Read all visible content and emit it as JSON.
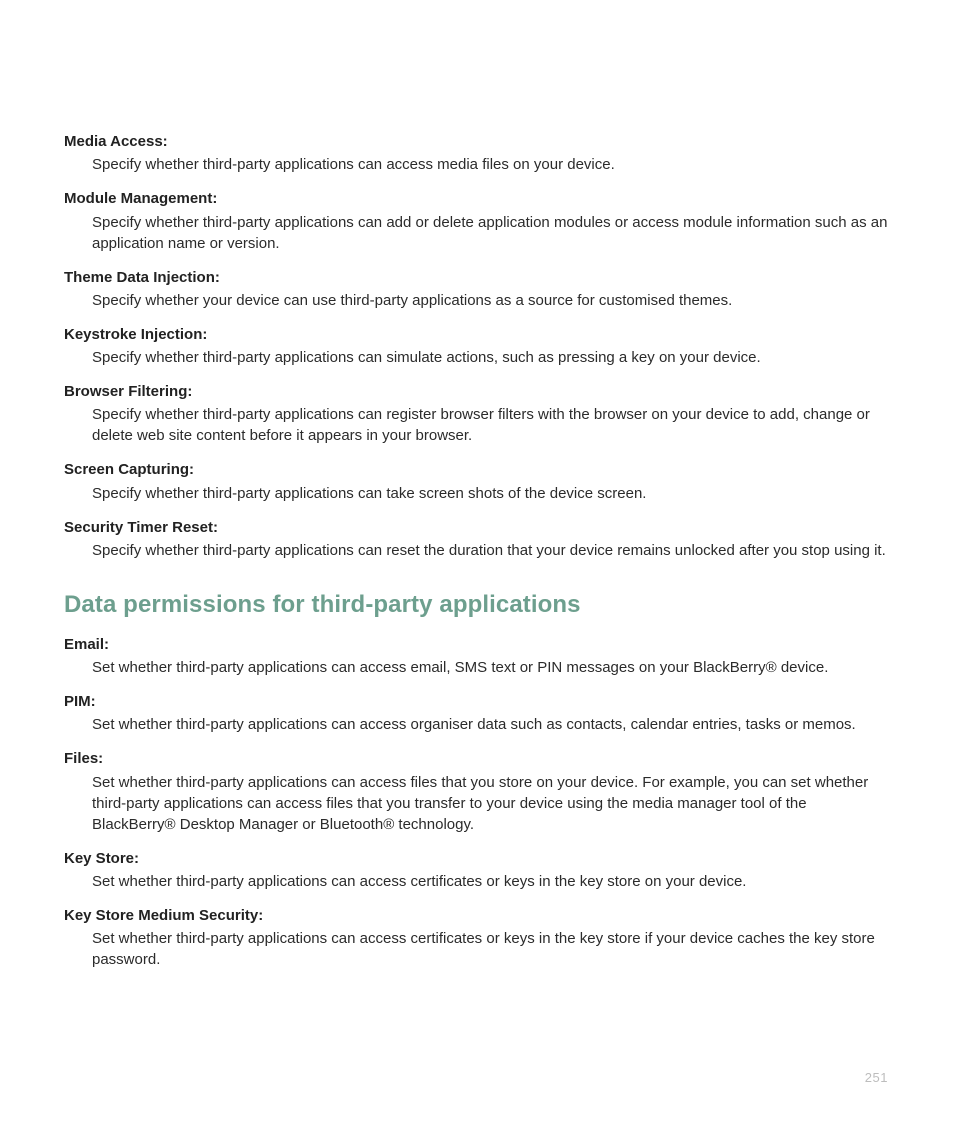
{
  "section1": {
    "items": [
      {
        "term": "Media Access:",
        "desc": "Specify whether third-party applications can access media files on your device."
      },
      {
        "term": "Module Management:",
        "desc": "Specify whether third-party applications can add or delete application modules or access module information such as an application name or version."
      },
      {
        "term": "Theme Data Injection:",
        "desc": "Specify whether your device can use third-party applications as a source for customised themes."
      },
      {
        "term": "Keystroke Injection:",
        "desc": "Specify whether third-party applications can simulate actions, such as pressing a key on your device."
      },
      {
        "term": "Browser Filtering:",
        "desc": "Specify whether third-party applications can register browser filters with the browser on your device to add, change or delete web site content before it appears in your browser."
      },
      {
        "term": "Screen Capturing:",
        "desc": "Specify whether third-party applications can take screen shots of the device screen."
      },
      {
        "term": "Security Timer Reset:",
        "desc": "Specify whether third-party applications can reset the duration that your device remains unlocked after you stop using it."
      }
    ]
  },
  "section2": {
    "heading": "Data permissions for third-party applications",
    "heading_color": "#6d9f8e",
    "items": [
      {
        "term": "Email:",
        "desc": "Set whether third-party applications can access email, SMS text or PIN messages on your BlackBerry® device."
      },
      {
        "term": "PIM:",
        "desc": "Set whether third-party applications can access organiser data such as contacts, calendar entries, tasks or memos."
      },
      {
        "term": "Files:",
        "desc": "Set whether third-party applications can access files that you store on your device. For example, you can set whether third-party applications can access files that you transfer to your device using the media manager tool of the BlackBerry® Desktop Manager or Bluetooth® technology."
      },
      {
        "term": "Key Store:",
        "desc": "Set whether third-party applications can access certificates or keys in the key store on your device."
      },
      {
        "term": "Key Store Medium Security:",
        "desc": "Set whether third-party applications can access certificates or keys in the key store if your device caches the key store password."
      }
    ]
  },
  "page_number": "251"
}
